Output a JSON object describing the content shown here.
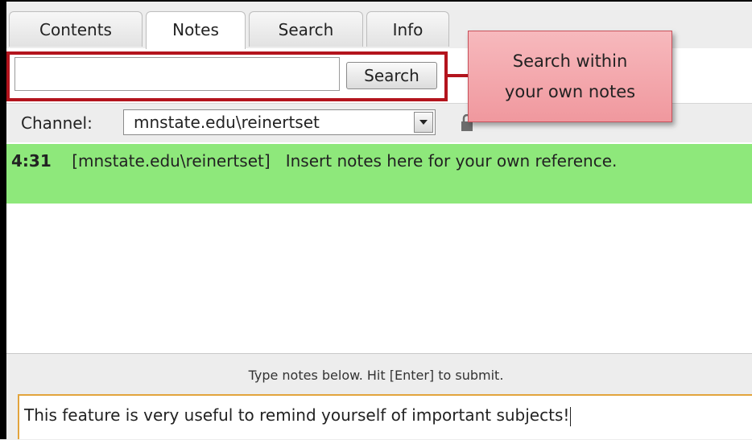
{
  "tabs": [
    {
      "label": "Contents",
      "active": false
    },
    {
      "label": "Notes",
      "active": true
    },
    {
      "label": "Search",
      "active": false
    },
    {
      "label": "Info",
      "active": false
    }
  ],
  "search": {
    "value": "",
    "placeholder": "",
    "button_label": "Search"
  },
  "callout": {
    "line1": "Search within",
    "line2": "your own notes"
  },
  "channel": {
    "label": "Channel:",
    "selected": "mnstate.edu\\reinertset"
  },
  "notes": [
    {
      "time": "4:31",
      "author": "[mnstate.edu\\reinertset]",
      "text": "Insert notes here for your own reference."
    }
  ],
  "footer": {
    "hint": "Type notes below. Hit [Enter] to submit.",
    "input_value": "This feature is very useful to remind yourself of important subjects!"
  },
  "colors": {
    "note_highlight": "#8ee87b",
    "callout_fill": "#f4a8ad",
    "highlight_border": "#b3141d",
    "input_focus": "#e2a43c"
  }
}
